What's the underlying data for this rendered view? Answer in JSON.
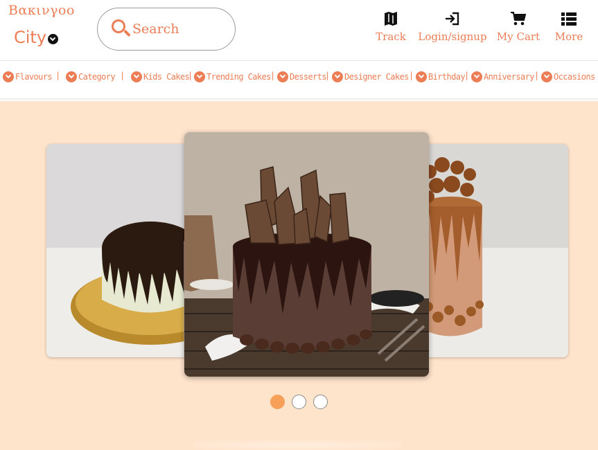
{
  "brand": {
    "logo_top": "Βακινγοο",
    "logo_bottom": "City"
  },
  "search": {
    "label": "Search"
  },
  "actions": [
    {
      "label": "Track",
      "icon": "map-icon"
    },
    {
      "label": "Login/signup",
      "icon": "login-icon"
    },
    {
      "label": "My Cart",
      "icon": "cart-icon"
    },
    {
      "label": "More",
      "icon": "list-icon"
    }
  ],
  "categories": [
    "Flavours",
    "Category",
    "Kids Cakes",
    "Trending Cakes",
    "Desserts",
    "Designer Cakes",
    "Birthday",
    "Anniversary",
    "Occasions"
  ],
  "carousel": {
    "slides": [
      {
        "position": "left",
        "subject": "chocolate drip cake on gold board"
      },
      {
        "position": "center",
        "subject": "chocolate cake with chocolate shards"
      },
      {
        "position": "right",
        "subject": "caramel drip cake with nuts"
      }
    ],
    "indicator_count": 3,
    "active_index": 0
  },
  "colors": {
    "accent": "#ec7d55",
    "hero_background": "#ffe4cc",
    "active_dot": "#f7a05a"
  }
}
